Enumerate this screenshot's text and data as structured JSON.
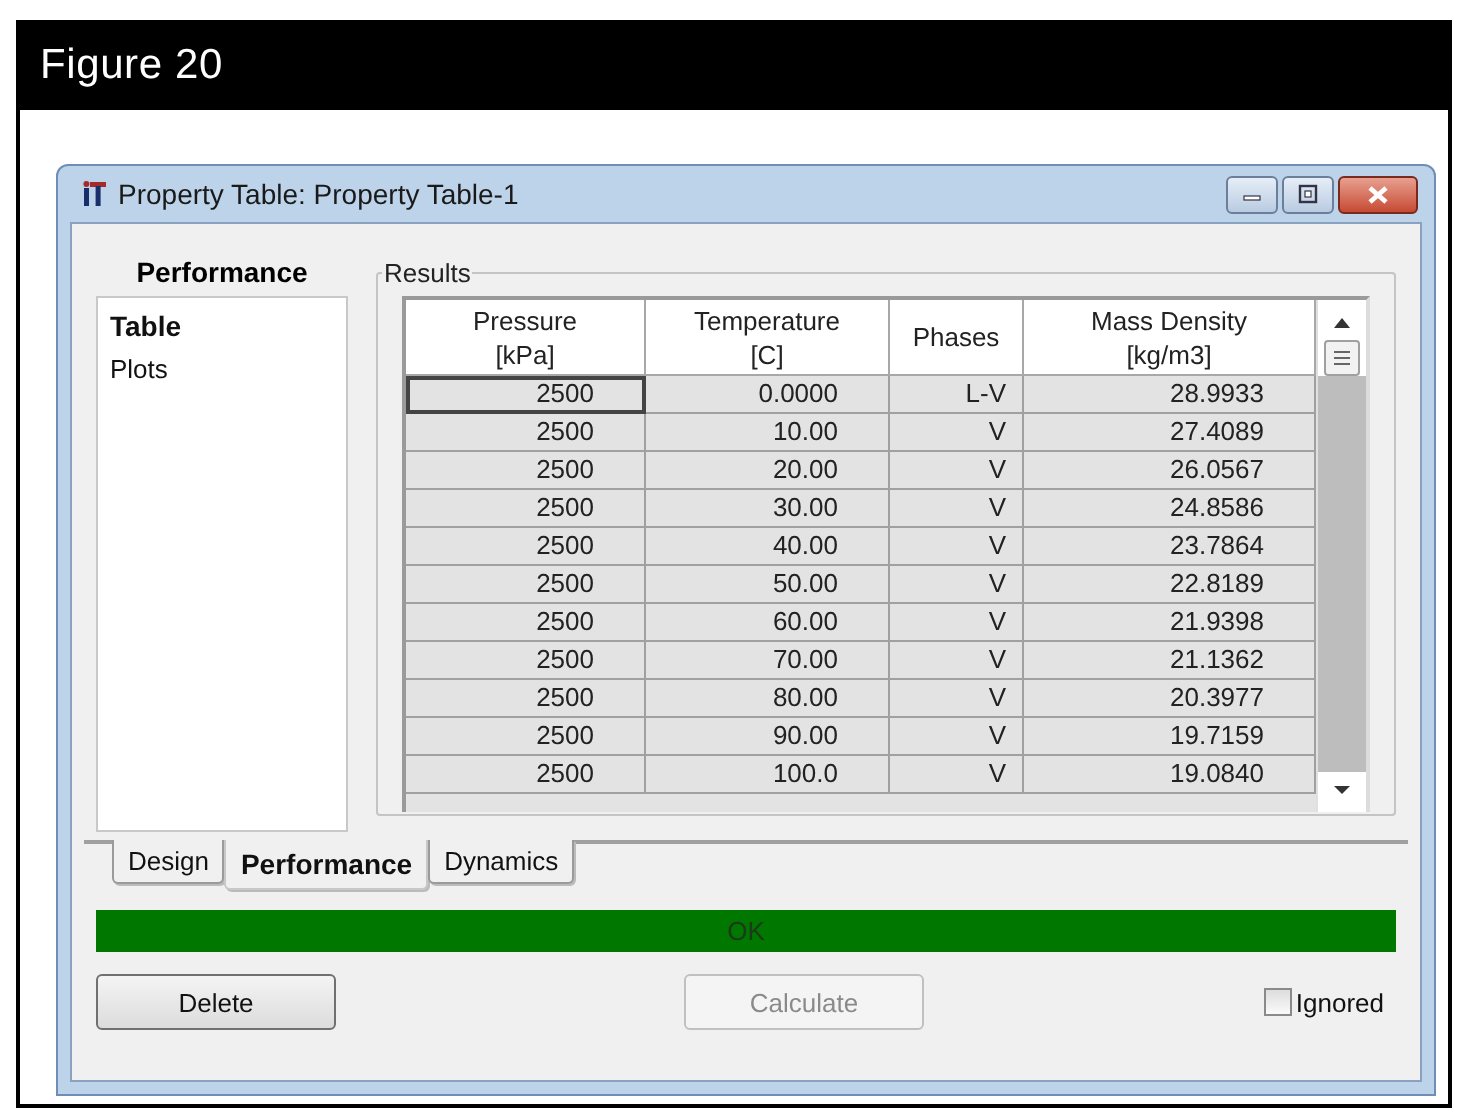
{
  "figure": {
    "title": "Figure 20"
  },
  "window": {
    "title": "Property Table: Property Table-1"
  },
  "side_panel": {
    "heading": "Performance",
    "items": [
      {
        "label": "Table",
        "selected": true
      },
      {
        "label": "Plots",
        "selected": false
      }
    ]
  },
  "results": {
    "legend": "Results",
    "columns": [
      {
        "label": "Pressure",
        "unit": "[kPa]"
      },
      {
        "label": "Temperature",
        "unit": "[C]"
      },
      {
        "label": "Phases"
      },
      {
        "label": "Mass Density",
        "unit": "[kg/m3]"
      }
    ],
    "rows": [
      {
        "cells": [
          "2500",
          "0.0000",
          "L-V",
          "28.9933"
        ],
        "selected": true
      },
      {
        "cells": [
          "2500",
          "10.00",
          "V",
          "27.4089"
        ],
        "selected": false
      },
      {
        "cells": [
          "2500",
          "20.00",
          "V",
          "26.0567"
        ],
        "selected": false
      },
      {
        "cells": [
          "2500",
          "30.00",
          "V",
          "24.8586"
        ],
        "selected": false
      },
      {
        "cells": [
          "2500",
          "40.00",
          "V",
          "23.7864"
        ],
        "selected": false
      },
      {
        "cells": [
          "2500",
          "50.00",
          "V",
          "22.8189"
        ],
        "selected": false
      },
      {
        "cells": [
          "2500",
          "60.00",
          "V",
          "21.9398"
        ],
        "selected": false
      },
      {
        "cells": [
          "2500",
          "70.00",
          "V",
          "21.1362"
        ],
        "selected": false
      },
      {
        "cells": [
          "2500",
          "80.00",
          "V",
          "20.3977"
        ],
        "selected": false
      },
      {
        "cells": [
          "2500",
          "90.00",
          "V",
          "19.7159"
        ],
        "selected": false
      },
      {
        "cells": [
          "2500",
          "100.0",
          "V",
          "19.0840"
        ],
        "selected": false
      }
    ]
  },
  "tabs": [
    {
      "label": "Design",
      "selected": false
    },
    {
      "label": "Performance",
      "selected": true
    },
    {
      "label": "Dynamics",
      "selected": false
    }
  ],
  "status": {
    "text": "OK",
    "color": "#007800"
  },
  "buttons": [
    {
      "label": "Delete",
      "disabled": false
    },
    {
      "label": "Calculate",
      "disabled": true
    }
  ],
  "ignored": {
    "label": "Ignored",
    "checked": false
  }
}
